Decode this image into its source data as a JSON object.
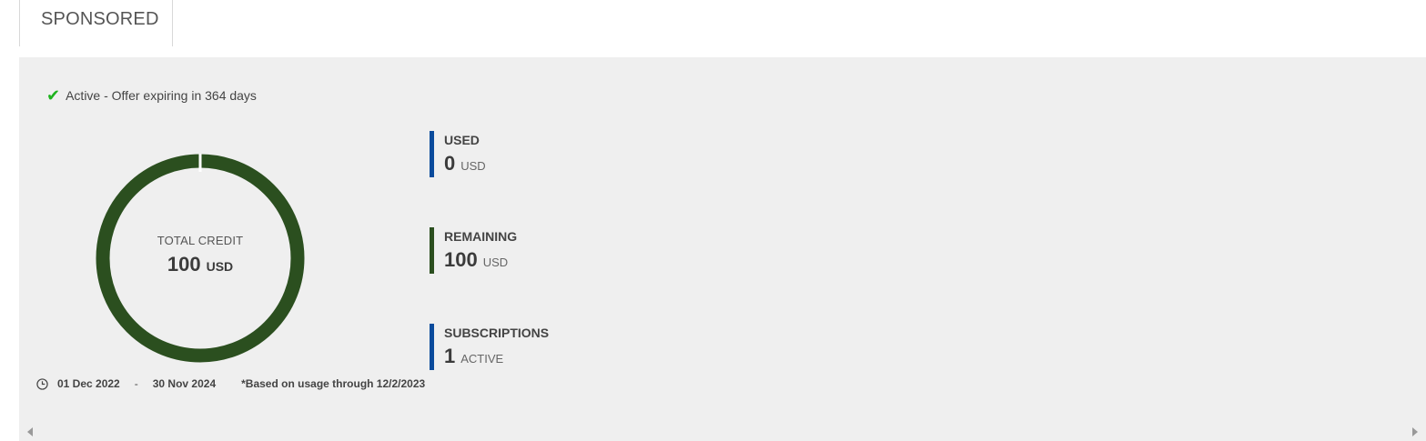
{
  "tab": {
    "label": "SPONSORED"
  },
  "status": {
    "icon": "check-icon",
    "text": "Active - Offer expiring in 364 days",
    "color": "#1eb31e"
  },
  "donut": {
    "title": "TOTAL CREDIT",
    "value": "100",
    "unit": "USD",
    "used_fraction": 0,
    "remaining_color": "#2b4f1f"
  },
  "stats": {
    "used": {
      "label": "USED",
      "value": "0",
      "unit": "USD",
      "color": "#0a4b9c"
    },
    "remaining": {
      "label": "REMAINING",
      "value": "100",
      "unit": "USD",
      "color": "#2b4f1f"
    },
    "subscriptions": {
      "label": "SUBSCRIPTIONS",
      "value": "1",
      "unit": "ACTIVE",
      "color": "#0a4b9c"
    }
  },
  "footer": {
    "icon": "clock-icon",
    "start_date": "01 Dec 2022",
    "separator": "-",
    "end_date": "30 Nov 2024",
    "note": "*Based on usage through 12/2/2023"
  },
  "scroll": {
    "left_icon": "scroll-left-icon",
    "right_icon": "scroll-right-icon"
  }
}
